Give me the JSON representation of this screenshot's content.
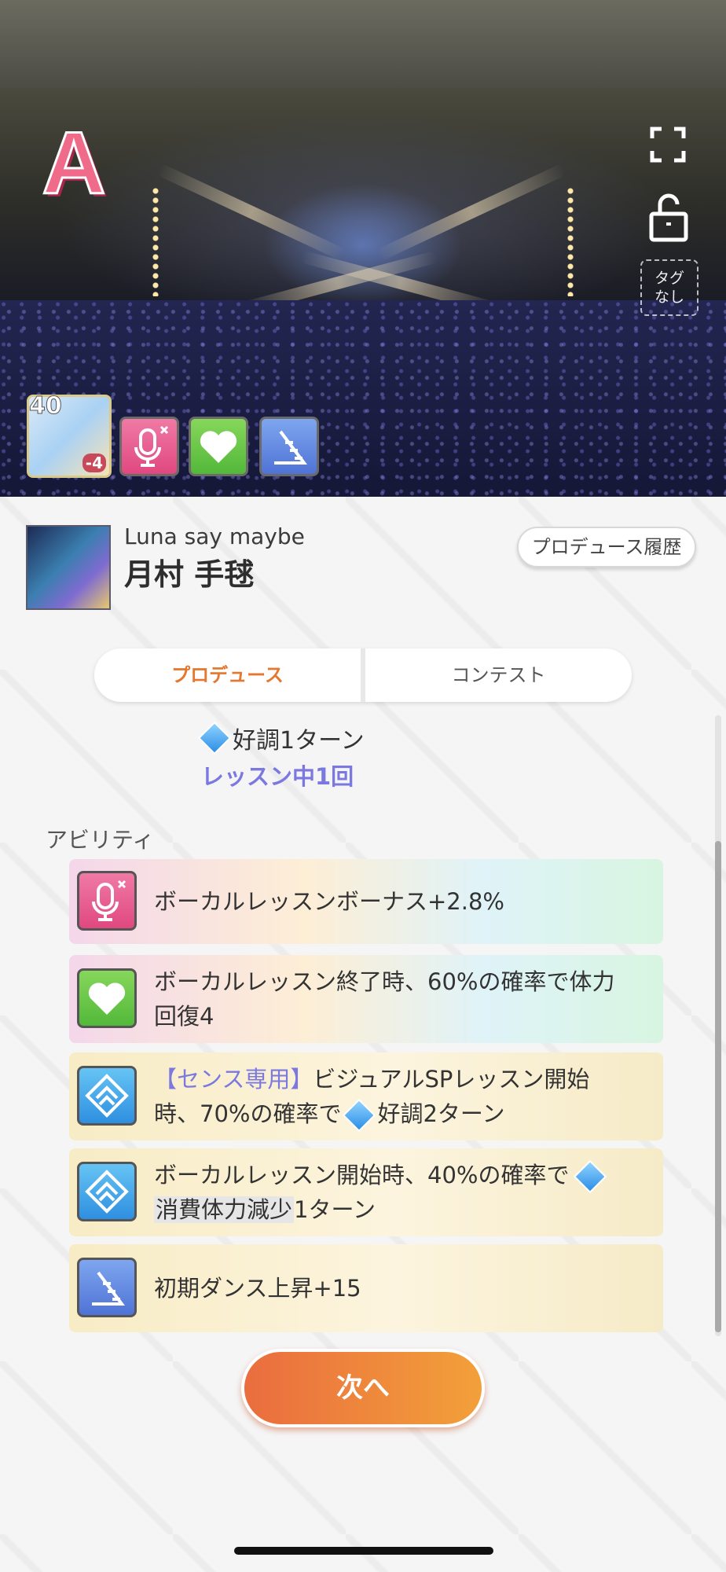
{
  "header": {
    "rank": "A",
    "tag_button": "タグ\nなし",
    "icons": [
      "fullscreen-icon",
      "unlock-icon"
    ],
    "support_card": {
      "level": "40",
      "penalty": "-4"
    }
  },
  "character": {
    "subtitle": "Luna say maybe",
    "name": "月村 手毬"
  },
  "buttons": {
    "history": "プロデュース履歴",
    "next": "次へ"
  },
  "tabs": [
    {
      "label": "プロデュース",
      "active": true
    },
    {
      "label": "コンテスト",
      "active": false
    }
  ],
  "previous": {
    "effect": "好調1ターン",
    "lesson": "レッスン中1回"
  },
  "abilities": {
    "title": "アビリティ",
    "items": [
      {
        "icon": "vocal-mic-icon",
        "text": "ボーカルレッスンボーナス+2.8%"
      },
      {
        "icon": "heart-icon",
        "text_line1": "ボーカルレッスン終了時、60%の確率で体力",
        "text_line2": "回復4"
      },
      {
        "icon": "diamond-skill-icon",
        "prefix": "【センス専用】",
        "text_line1": "ビジュアルSPレッスン開始",
        "text_line2a": "時、70%の確率で",
        "text_line2b": "好調2ターン"
      },
      {
        "icon": "diamond-skill-icon",
        "text_line1": "ボーカルレッスン開始時、40%の確率で",
        "text_line2a": "消費体力減少",
        "text_line2b": "1ターン"
      },
      {
        "icon": "dance-stairs-icon",
        "text": "初期ダンス上昇+15"
      }
    ]
  }
}
